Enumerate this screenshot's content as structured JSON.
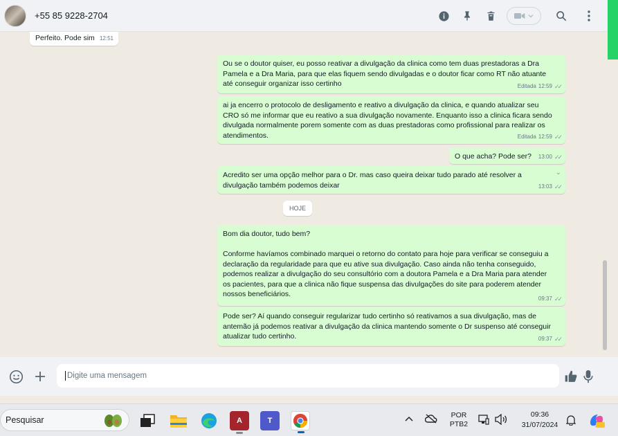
{
  "header": {
    "contact_name": "+55 85 9228-2704",
    "icons": [
      "info-icon",
      "pin-icon",
      "trash-icon",
      "video-call-icon",
      "search-icon",
      "menu-icon"
    ]
  },
  "messages": [
    {
      "dir": "in",
      "text": "Perfeito. Pode sim",
      "time": "12:51",
      "edited": ""
    },
    {
      "dir": "out",
      "text": "Ou se o doutor quiser, eu posso reativar a divulgação da clinica como tem duas prestadoras a Dra Pamela e a Dra Maria, para que elas fiquem sendo divulgadas e o doutor ficar como RT não atuante até conseguir organizar isso certinho",
      "time": "12:59",
      "edited": "Editada"
    },
    {
      "dir": "out",
      "text": "ai ja encerro o protocolo de desligamento e reativo a divulgação da clinica, e quando atualizar seu CRO só me informar que eu reativo a sua divulgação novamente. Enquanto isso a clinica ficara sendo divulgada normalmente porem somente com as duas prestadoras como profissional para realizar os atendimentos.",
      "time": "12:59",
      "edited": "Editada"
    },
    {
      "dir": "out",
      "text": "O que acha? Pode ser?",
      "time": "13:00",
      "edited": ""
    },
    {
      "dir": "out",
      "text": "Acredito ser uma opção melhor para o Dr. mas caso queira deixar tudo parado até resolver a divulgação também podemos deixar",
      "time": "13:03",
      "edited": ""
    },
    {
      "dir": "out",
      "text": "Bom dia doutor, tudo bem?\n\nConforme havíamos combinado marquei o retorno do contato para hoje para verificar se conseguiu a declaração da regularidade para que eu ative sua divulgação. Caso ainda não tenha conseguido, podemos realizar a divulgação do seu consultório com a doutora Pamela e a Dra Maria para atender os pacientes, para que a clinica não fique suspensa das divulgações do site para poderem atender nossos beneficiários.",
      "time": "09:37",
      "edited": ""
    },
    {
      "dir": "out",
      "text": "Pode ser? Aí quando conseguir regularizar tudo certinho só reativamos a sua divulgação, mas de antemão já podemos reativar a divulgação da clinica mantendo somente o Dr suspenso até conseguir atualizar tudo certinho.",
      "time": "09:37",
      "edited": ""
    }
  ],
  "day_separator": "HOJE",
  "compose": {
    "placeholder": "Digite uma mensagem",
    "icons": [
      "emoji-icon",
      "plus-icon",
      "thumbs-up-icon",
      "microphone-icon"
    ]
  },
  "taskbar": {
    "search_label": "Pesquisar",
    "lang_line1": "POR",
    "lang_line2": "PTB2",
    "time": "09:36",
    "date": "31/07/2024",
    "apps": [
      "task-view-icon",
      "file-explorer-icon",
      "edge-icon",
      "access-icon",
      "teams-icon",
      "chrome-icon"
    ]
  },
  "colors": {
    "outgoing_bubble": "#d9fdd3",
    "incoming_bubble": "#ffffff",
    "chat_bg": "#efeae2",
    "accent": "#25d366"
  }
}
